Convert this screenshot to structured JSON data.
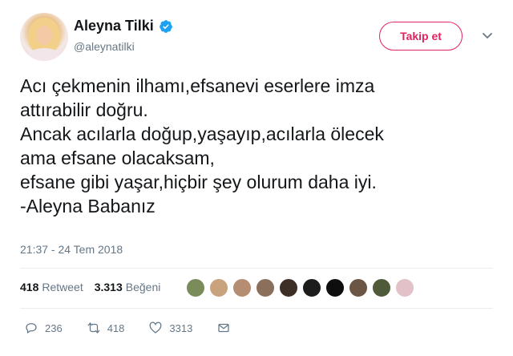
{
  "user": {
    "name": "Aleyna Tilki",
    "handle": "@aleynatilki",
    "verified": true
  },
  "follow_button": {
    "label": "Takip et"
  },
  "tweet": {
    "lines": [
      "Acı çekmenin ilhamı,efsanevi eserlere imza",
      "attırabilir doğru.",
      "Ancak acılarla doğup,yaşayıp,acılarla ölecek",
      "ama efsane olacaksam,",
      "efsane gibi yaşar,hiçbir şey olurum daha iyi.",
      "-Aleyna Babanız"
    ],
    "timestamp": "21:37 - 24 Tem 2018"
  },
  "stats": {
    "retweets": "418",
    "retweets_label": "Retweet",
    "likes": "3.313",
    "likes_label": "Beğeni"
  },
  "likers": [
    {
      "color": "#7a8c5a"
    },
    {
      "color": "#c9a27e"
    },
    {
      "color": "#b58d72"
    },
    {
      "color": "#8a6f5a"
    },
    {
      "color": "#3d2e26"
    },
    {
      "color": "#1c1c1c"
    },
    {
      "color": "#0e0e0e"
    },
    {
      "color": "#6b5646"
    },
    {
      "color": "#4e5a3a"
    },
    {
      "color": "#e2c1c8"
    }
  ],
  "actions": {
    "replies": "236",
    "retweets": "418",
    "likes": "3313"
  },
  "colors": {
    "accent": "#e0245e",
    "verified": "#1da1f2",
    "muted": "#657786"
  }
}
